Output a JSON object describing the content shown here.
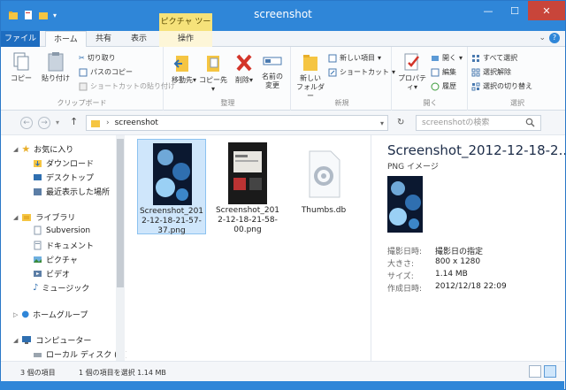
{
  "window": {
    "title": "screenshot",
    "context_tab_top": "ピクチャ ツール"
  },
  "tabs": {
    "file": "ファイル",
    "home": "ホーム",
    "share": "共有",
    "view": "表示",
    "ops": "操作"
  },
  "ribbon": {
    "clipboard": {
      "label": "クリップボード",
      "copy": "コピー",
      "paste": "貼り付け",
      "cut": "切り取り",
      "copy_path": "パスのコピー",
      "paste_shortcut": "ショートカットの貼り付け"
    },
    "organize": {
      "label": "整理",
      "move_to": "移動先",
      "copy_to": "コピー先",
      "delete": "削除",
      "rename_line1": "名前の",
      "rename_line2": "変更"
    },
    "new": {
      "label": "新規",
      "new_folder_line1": "新しい",
      "new_folder_line2": "フォルダー",
      "new_item": "新しい項目",
      "shortcut": "ショートカット"
    },
    "open": {
      "label": "開く",
      "properties": "プロパティ",
      "open": "開く",
      "edit": "編集",
      "history": "履歴"
    },
    "select": {
      "label": "選択",
      "select_all": "すべて選択",
      "select_none": "選択解除",
      "invert": "選択の切り替え"
    }
  },
  "address": {
    "path": "screenshot",
    "search_placeholder": "screenshotの検索"
  },
  "nav": {
    "favorites": "お気に入り",
    "downloads": "ダウンロード",
    "desktop": "デスクトップ",
    "recent": "最近表示した場所",
    "libraries": "ライブラリ",
    "subversion": "Subversion",
    "documents": "ドキュメント",
    "pictures": "ピクチャ",
    "videos": "ビデオ",
    "music": "ミュージック",
    "homegroup": "ホームグループ",
    "computer": "コンピューター",
    "local_disk": "ローカル ディスク (C:)"
  },
  "files": [
    {
      "name_line1": "Screenshot_201",
      "name_line2": "2-12-18-21-57-",
      "name_line3": "37.png"
    },
    {
      "name_line1": "Screenshot_201",
      "name_line2": "2-12-18-21-58-",
      "name_line3": "00.png"
    },
    {
      "name_line1": "Thumbs.db",
      "name_line2": "",
      "name_line3": ""
    }
  ],
  "details": {
    "title": "Screenshot_2012-12-18-2...",
    "type": "PNG イメージ",
    "rows": [
      {
        "k": "撮影日時:",
        "v": "撮影日の指定"
      },
      {
        "k": "大きさ:",
        "v": "800 x 1280"
      },
      {
        "k": "サイズ:",
        "v": "1.14 MB"
      },
      {
        "k": "作成日時:",
        "v": "2012/12/18 22:09"
      }
    ]
  },
  "status": {
    "count": "3 個の項目",
    "selected": "1 個の項目を選択  1.14 MB"
  },
  "colors": {
    "accent": "#2f86d8",
    "file_tab": "#1e6dc0",
    "context_tab": "#f6e27a",
    "close": "#c8453a",
    "selection": "#cfe6fb"
  }
}
